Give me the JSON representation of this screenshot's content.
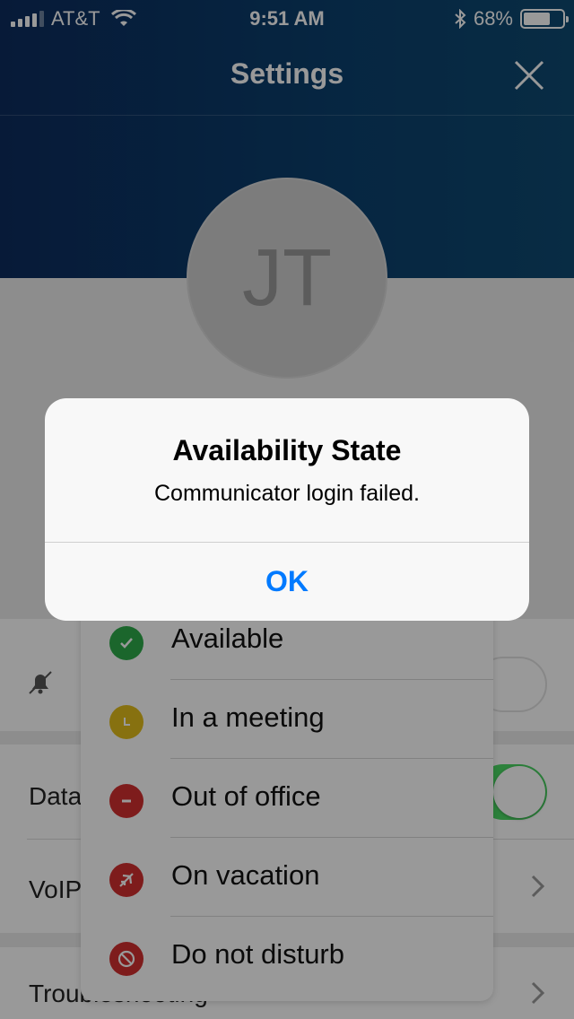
{
  "status_bar": {
    "carrier": "AT&T",
    "time": "9:51 AM",
    "battery": "68%",
    "battery_level": 0.68
  },
  "nav": {
    "title": "Settings"
  },
  "profile": {
    "initials": "JT"
  },
  "rows": {
    "data_label": "Data",
    "voip_label": "VoIP",
    "troubleshooting_label": "Troubleshooting"
  },
  "availability": {
    "items": [
      {
        "label": "Available",
        "color": "#2daa4a",
        "icon": "check-icon"
      },
      {
        "label": "In a meeting",
        "color": "#e2bd1c",
        "icon": "clock-icon"
      },
      {
        "label": "Out of office",
        "color": "#d32f2f",
        "icon": "minus-icon"
      },
      {
        "label": "On vacation",
        "color": "#d32f2f",
        "icon": "airplane-icon"
      },
      {
        "label": "Do not disturb",
        "color": "#d32f2f",
        "icon": "no-entry-icon"
      }
    ]
  },
  "alert": {
    "title": "Availability State",
    "message": "Communicator login failed.",
    "ok_label": "OK"
  },
  "colors": {
    "accent": "#007aff",
    "header": "#0b3f6d",
    "toggle_on": "#4bd964"
  }
}
